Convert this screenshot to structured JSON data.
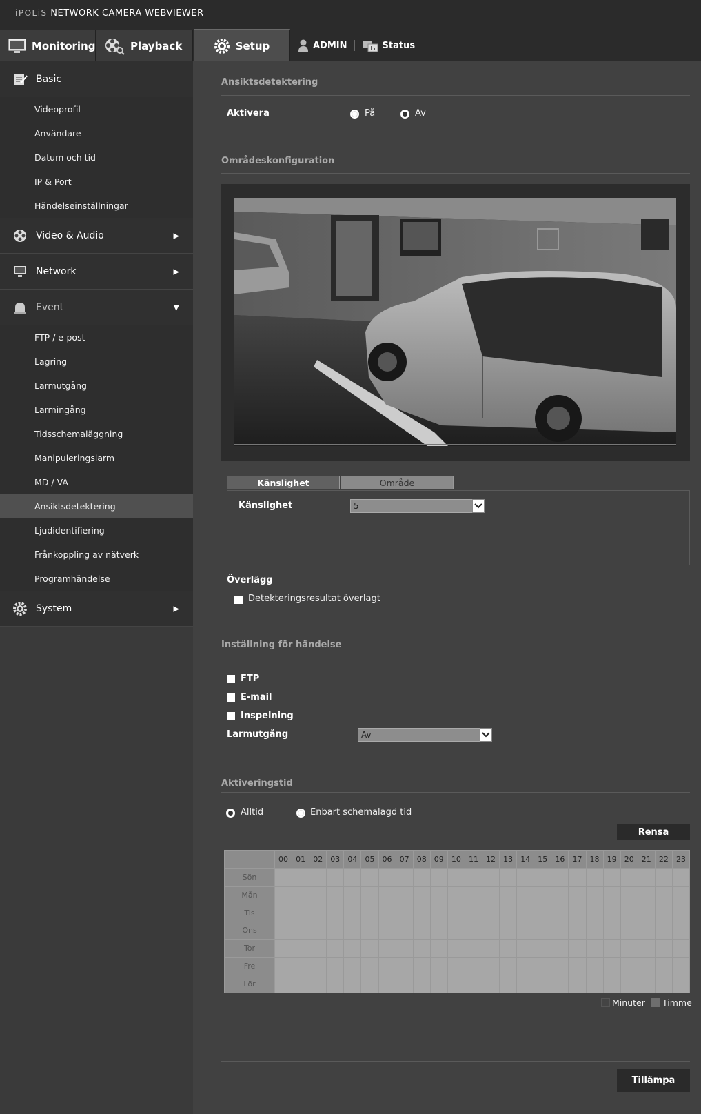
{
  "header": {
    "brand_prefix": "iPOLiS",
    "brand_suffix": "NETWORK CAMERA WEBVIEWER",
    "tabs": {
      "monitoring": "Monitoring",
      "playback": "Playback",
      "setup": "Setup"
    },
    "user": "ADMIN",
    "status": "Status"
  },
  "sidebar": {
    "basic": {
      "label": "Basic",
      "items": [
        "Videoprofil",
        "Användare",
        "Datum och tid",
        "IP & Port",
        "Händelseinställningar"
      ]
    },
    "video_audio": "Video & Audio",
    "network": "Network",
    "event": {
      "label": "Event",
      "items": [
        "FTP / e-post",
        "Lagring",
        "Larmutgång",
        "Larmingång",
        "Tidsschemaläggning",
        "Manipuleringslarm",
        "MD / VA",
        "Ansiktsdetektering",
        "Ljudidentifiering",
        "Frånkoppling av nätverk",
        "Programhändelse"
      ]
    },
    "system": "System"
  },
  "main": {
    "face_detection": {
      "title": "Ansiktsdetektering",
      "enable_label": "Aktivera",
      "on": "På",
      "off": "Av"
    },
    "area_config": {
      "title": "Områdeskonfiguration"
    },
    "subtabs": {
      "sensitivity": "Känslighet",
      "area": "Område"
    },
    "sensitivity": {
      "label": "Känslighet",
      "value": "5"
    },
    "overlay": {
      "label": "Överlägg",
      "checkbox": "Detekteringsresultat överlagt"
    },
    "event_setting": {
      "title": "Inställning för händelse",
      "ftp": "FTP",
      "email": "E-mail",
      "recording": "Inspelning",
      "alarm_out_label": "Larmutgång",
      "alarm_out_value": "Av"
    },
    "activation": {
      "title": "Aktiveringstid",
      "always": "Alltid",
      "scheduled": "Enbart schemalagd tid",
      "clear": "Rensa"
    },
    "schedule": {
      "hours": [
        "00",
        "01",
        "02",
        "03",
        "04",
        "05",
        "06",
        "07",
        "08",
        "09",
        "10",
        "11",
        "12",
        "13",
        "14",
        "15",
        "16",
        "17",
        "18",
        "19",
        "20",
        "21",
        "22",
        "23"
      ],
      "days": [
        "Sön",
        "Mån",
        "Tis",
        "Ons",
        "Tor",
        "Fre",
        "Lör"
      ]
    },
    "legend": {
      "minutes": "Minuter",
      "hour": "Timme"
    },
    "apply": "Tillämpa"
  }
}
